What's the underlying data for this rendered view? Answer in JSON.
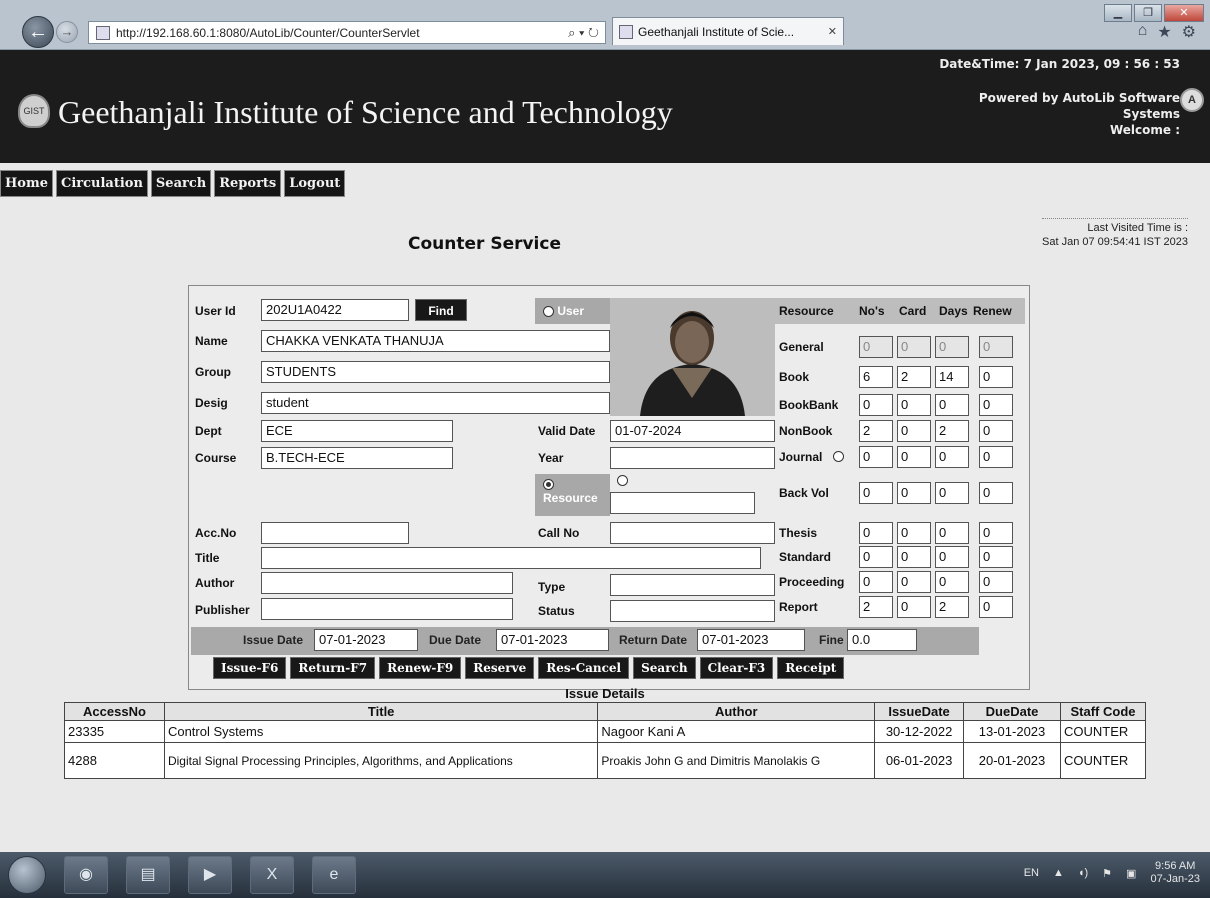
{
  "browser": {
    "url": "http://192.168.60.1:8080/AutoLib/Counter/CounterServlet",
    "tab_title": "Geethanjali Institute of Scie...",
    "tab_close": "✕",
    "address_tools": "⌕ ▾ ↻"
  },
  "header": {
    "institution": "Geethanjali Institute of Science and Technology",
    "datetime": "Date&Time:  7 Jan 2023, 09 : 56 : 53",
    "powered_by": "Powered by AutoLib Software",
    "powered_by_2": "Systems",
    "welcome": "Welcome   :"
  },
  "menu": [
    "Home",
    "Circulation",
    "Search",
    "Reports",
    "Logout"
  ],
  "last_visited": {
    "label": "Last Visited Time is :",
    "value": "Sat Jan 07 09:54:41 IST 2023"
  },
  "page_title": "Counter Service",
  "form": {
    "user_id_label": "User Id",
    "user_id": "202U1A0422",
    "find_label": "Find",
    "user_radio_label": "User",
    "name_label": "Name",
    "name": "CHAKKA VENKATA THANUJA",
    "group_label": "Group",
    "group": "STUDENTS",
    "desig_label": "Desig",
    "desig": "student",
    "dept_label": "Dept",
    "dept": "ECE",
    "valid_date_label": "Valid Date",
    "valid_date": "01-07-2024",
    "course_label": "Course",
    "course": "B.TECH-ECE",
    "year_label": "Year",
    "year": "",
    "resource_radio_label": "Resource",
    "resource_value": "",
    "acc_no_label": "Acc.No",
    "acc_no": "",
    "call_no_label": "Call No",
    "call_no": "",
    "title_label": "Title",
    "title": "",
    "author_label": "Author",
    "author": "",
    "type_label": "Type",
    "type": "",
    "publisher_label": "Publisher",
    "publisher": "",
    "status_label": "Status",
    "status": "",
    "issue_date_label": "Issue Date",
    "issue_date": "07-01-2023",
    "due_date_label": "Due Date",
    "due_date": "07-01-2023",
    "return_date_label": "Return Date",
    "return_date": "07-01-2023",
    "fine_label": "Fine",
    "fine": "0.0"
  },
  "resources": {
    "headers": [
      "Resource",
      "No's",
      "Card",
      "Days",
      "Renew"
    ],
    "rows": [
      {
        "name": "General",
        "values": [
          "0",
          "0",
          "0",
          "0"
        ]
      },
      {
        "name": "Book",
        "values": [
          "6",
          "2",
          "14",
          "0"
        ]
      },
      {
        "name": "BookBank",
        "values": [
          "0",
          "0",
          "0",
          "0"
        ]
      },
      {
        "name": "NonBook",
        "values": [
          "2",
          "0",
          "2",
          "0"
        ]
      },
      {
        "name": "Journal",
        "values": [
          "0",
          "0",
          "0",
          "0"
        ]
      },
      {
        "name": "Back Vol",
        "values": [
          "0",
          "0",
          "0",
          "0"
        ]
      },
      {
        "name": "Thesis",
        "values": [
          "0",
          "0",
          "0",
          "0"
        ]
      },
      {
        "name": "Standard",
        "values": [
          "0",
          "0",
          "0",
          "0"
        ]
      },
      {
        "name": "Proceeding",
        "values": [
          "0",
          "0",
          "0",
          "0"
        ]
      },
      {
        "name": "Report",
        "values": [
          "2",
          "0",
          "2",
          "0"
        ]
      }
    ]
  },
  "actions": [
    "Issue-F6",
    "Return-F7",
    "Renew-F9",
    "Reserve",
    "Res-Cancel",
    "Search",
    "Clear-F3",
    "Receipt"
  ],
  "issue_details": {
    "title": "Issue Details",
    "columns": [
      "AccessNo",
      "Title",
      "Author",
      "IssueDate",
      "DueDate",
      "Staff Code"
    ],
    "rows": [
      [
        "23335",
        "Control Systems",
        "Nagoor Kani A",
        "30-12-2022",
        "13-01-2023",
        "COUNTER"
      ],
      [
        "4288",
        "Digital Signal Processing Principles, Algorithms, and Applications",
        "Proakis John G and Dimitris Manolakis G",
        "06-01-2023",
        "20-01-2023",
        "COUNTER"
      ]
    ]
  },
  "taskbar": {
    "language": "EN",
    "time": "9:56 AM",
    "date": "07-Jan-23"
  }
}
